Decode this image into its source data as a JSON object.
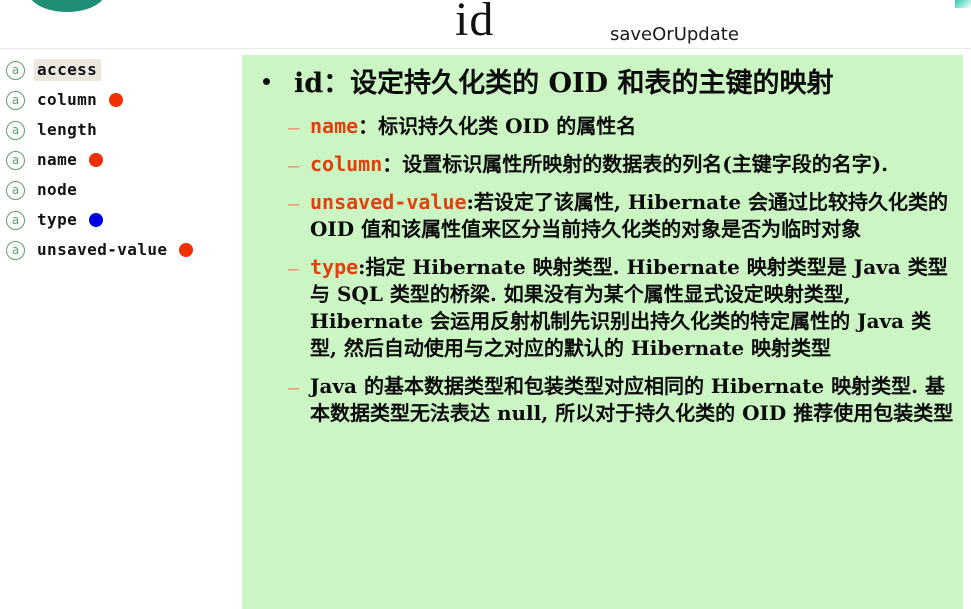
{
  "header": {
    "title": "id",
    "subtitle": "saveOrUpdate"
  },
  "colors": {
    "content_background": "#ccf5c4",
    "keyword": "#e2400c",
    "dash": "#f08a6a",
    "dot_red": "#f03000",
    "dot_blue": "#0000e0",
    "icon_green": "#5f9e6e",
    "selected_highlight": "#ebe7de",
    "corner_teal": "#1e8f76"
  },
  "sidebar": {
    "items": [
      {
        "icon": "at-attribute-icon",
        "label": "access",
        "marker": "none"
      },
      {
        "icon": "at-attribute-icon",
        "label": "column",
        "marker": "red"
      },
      {
        "icon": "at-attribute-icon",
        "label": "length",
        "marker": "none"
      },
      {
        "icon": "at-attribute-icon",
        "label": "name",
        "marker": "red"
      },
      {
        "icon": "at-attribute-icon",
        "label": "node",
        "marker": "none"
      },
      {
        "icon": "at-attribute-icon",
        "label": "type",
        "marker": "blue"
      },
      {
        "icon": "at-attribute-icon",
        "label": "unsaved-value",
        "marker": "red"
      }
    ],
    "icon_glyph": "a",
    "selected_index": 0
  },
  "content": {
    "main_bullet": "id：设定持久化类的 OID 和表的主键的映射",
    "sub_bullets": [
      {
        "keyword": "name",
        "separator": "：",
        "body": "标识持久化类 OID 的属性名"
      },
      {
        "keyword": "column",
        "separator": "：",
        "body": "设置标识属性所映射的数据表的列名(主键字段的名字)."
      },
      {
        "keyword": "unsaved-value",
        "separator": ":",
        "body": "若设定了该属性, Hibernate 会通过比较持久化类的 OID 值和该属性值来区分当前持久化类的对象是否为临时对象"
      },
      {
        "keyword": "type",
        "separator": ":",
        "body": "指定 Hibernate 映射类型. Hibernate 映射类型是 Java 类型与 SQL 类型的桥梁. 如果没有为某个属性显式设定映射类型, Hibernate 会运用反射机制先识别出持久化类的特定属性的 Java 类型, 然后自动使用与之对应的默认的 Hibernate 映射类型"
      },
      {
        "keyword": "",
        "separator": "",
        "body": "Java 的基本数据类型和包装类型对应相同的 Hibernate 映射类型. 基本数据类型无法表达 null, 所以对于持久化类的 OID 推荐使用包装类型"
      }
    ]
  }
}
